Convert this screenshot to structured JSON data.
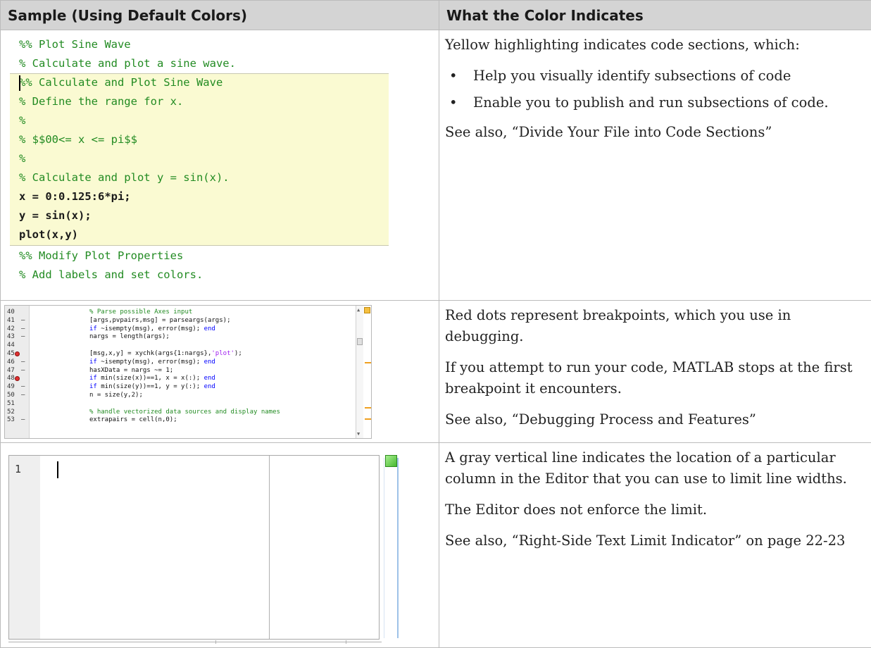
{
  "table": {
    "headers": [
      "Sample (Using Default Colors)",
      "What the Color Indicates"
    ]
  },
  "row1": {
    "code": [
      "%% Plot Sine Wave",
      "% Calculate and plot a sine wave.",
      "%% Calculate and Plot Sine Wave",
      "% Define the range for x.",
      "%",
      "% $$00<= x <= pi$$",
      "%",
      "% Calculate and plot y = sin(x).",
      "x = 0:0.125:6*pi;",
      "y = sin(x);",
      "plot(x,y)",
      "%% Modify Plot Properties",
      "% Add labels and set colors."
    ],
    "desc_intro": "Yellow highlighting indicates code sections, which:",
    "bullets": [
      "Help you visually identify subsections of code",
      "Enable you to publish and run subsections of code."
    ],
    "see_also": "See also, “Divide Your File into Code Sections”",
    "highlight_color": "#fafad2",
    "comment_color": "#228B22"
  },
  "row2": {
    "code": [
      {
        "num": "40",
        "dash": "",
        "bp": false,
        "text": "% Parse possible Axes input"
      },
      {
        "num": "41",
        "dash": "–",
        "bp": false,
        "text": "[args,pvpairs,msg] = parseargs(args);"
      },
      {
        "num": "42",
        "dash": "–",
        "bp": false,
        "text": "if ~isempty(msg), error(msg); end"
      },
      {
        "num": "43",
        "dash": "–",
        "bp": false,
        "text": "nargs = length(args);"
      },
      {
        "num": "44",
        "dash": "",
        "bp": false,
        "text": ""
      },
      {
        "num": "45",
        "dash": "",
        "bp": true,
        "text": "[msg,x,y] = xychk(args{1:nargs},'plot');"
      },
      {
        "num": "46",
        "dash": "–",
        "bp": false,
        "text": "if ~isempty(msg), error(msg); end"
      },
      {
        "num": "47",
        "dash": "–",
        "bp": false,
        "text": "hasXData = nargs ~= 1;"
      },
      {
        "num": "48",
        "dash": "",
        "bp": true,
        "text": "if min(size(x))==1, x = x(:); end"
      },
      {
        "num": "49",
        "dash": "–",
        "bp": false,
        "text": "if min(size(y))==1, y = y(:); end"
      },
      {
        "num": "50",
        "dash": "–",
        "bp": false,
        "text": "n = size(y,2);"
      },
      {
        "num": "51",
        "dash": "",
        "bp": false,
        "text": ""
      },
      {
        "num": "52",
        "dash": "",
        "bp": false,
        "text": "% handle vectorized data sources and display names"
      },
      {
        "num": "53",
        "dash": "–",
        "bp": false,
        "text": "extrapairs = cell(n,0);"
      }
    ],
    "desc": [
      "Red dots represent breakpoints, which you use in debugging.",
      "If you attempt to run your code, MATLAB stops at the first breakpoint it encounters.",
      "See also, “Debugging Process and Features”"
    ],
    "breakpoint_color": "#e03030"
  },
  "row3": {
    "line_number": "1",
    "desc": [
      "A gray vertical line indicates the location of a particular column in the Editor that you can use to limit line widths.",
      "The Editor does not enforce the limit.",
      "See also, “Right-Side Text Limit Indicator” on page 22-23"
    ],
    "limit_line_color": "#b0b0b0"
  }
}
